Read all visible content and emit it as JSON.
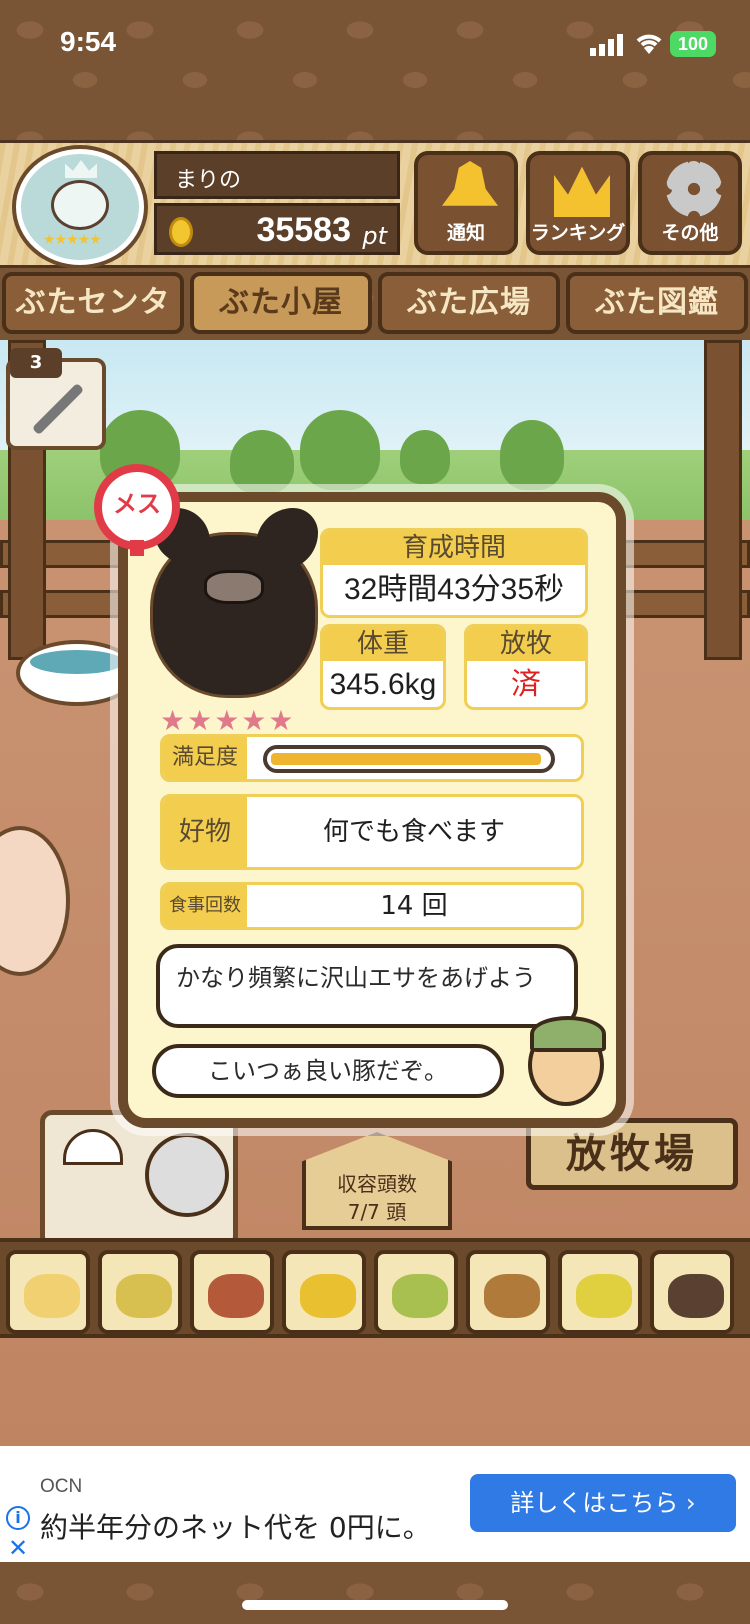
{
  "status_bar": {
    "time": "9:54",
    "battery": "100"
  },
  "header": {
    "player_name": "まりの",
    "points": "35583",
    "points_unit": "pt",
    "buttons": [
      {
        "label": "通知",
        "icon": "bell-icon"
      },
      {
        "label": "ランキング",
        "icon": "crown-icon"
      },
      {
        "label": "その他",
        "icon": "gear-icon"
      }
    ]
  },
  "tabs": [
    {
      "label": "ぶたセンター",
      "active": false
    },
    {
      "label": "ぶた小屋",
      "active": true
    },
    {
      "label": "ぶた広場",
      "active": false
    },
    {
      "label": "ぶた図鑑",
      "active": false
    }
  ],
  "medicine_count": "3",
  "pig_card": {
    "gender_badge": "メス",
    "rating_stars": "★★★★★",
    "rating": 5,
    "growth_time_label": "育成時間",
    "growth_time": "32時間43分35秒",
    "weight_label": "体重",
    "weight": "345.6kg",
    "grazing_label": "放牧",
    "grazing_status": "済",
    "satisfaction_label": "満足度",
    "satisfaction_level": 0.98,
    "favorite_label": "好物",
    "favorite": "何でも食べます",
    "meals_label": "食事回数",
    "meals": "14 回",
    "advice": "かなり頻繁に沢山エサをあげよう",
    "farmer_comment": "こいつぁ良い豚だぞ。"
  },
  "capacity": {
    "label": "収容頭数",
    "value": "7/7 頭"
  },
  "pasture_sign": "放牧場",
  "feeds": [
    "grain-feed-icon",
    "mixed-grain-feed-icon",
    "sweet-potato-icon",
    "corn-icon",
    "soybean-icon",
    "acorn-icon",
    "grain-bowl-icon",
    "premium-feed-icon"
  ],
  "ad": {
    "brand": "OCN",
    "text": "約半年分のネット代を 0円に。",
    "cta": "詳しくはこちら ›"
  },
  "colors": {
    "accent": "#f3cd4e",
    "wood": "#7a5232",
    "female": "#e13b48",
    "grazing_done": "#e02020",
    "ad_button": "#2f7ae5"
  }
}
